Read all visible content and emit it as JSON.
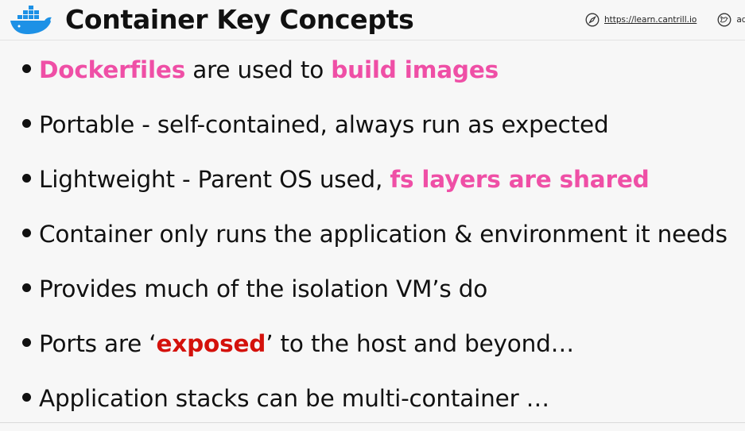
{
  "header": {
    "title": "Container Key Concepts",
    "website": "https://learn.cantrill.io",
    "social": "adria",
    "icons": {
      "logo": "docker-whale-icon",
      "website": "compass-icon",
      "social": "twitter-bird-icon"
    }
  },
  "colors": {
    "accent_pink": "#ef4fa6",
    "accent_red": "#d4110b",
    "docker_blue": "#1d91e6"
  },
  "bullets": [
    {
      "parts": [
        {
          "text": "Dockerfiles",
          "style": "pink"
        },
        {
          "text": " are used to "
        },
        {
          "text": "build images",
          "style": "pink"
        }
      ]
    },
    {
      "parts": [
        {
          "text": "Portable - self-contained, always run as expected"
        }
      ]
    },
    {
      "parts": [
        {
          "text": "Lightweight - Parent OS used, "
        },
        {
          "text": "fs layers are shared",
          "style": "pink"
        }
      ]
    },
    {
      "parts": [
        {
          "text": "Container only runs the application & environment it needs"
        }
      ]
    },
    {
      "parts": [
        {
          "text": "Provides much of the isolation VM’s do"
        }
      ]
    },
    {
      "parts": [
        {
          "text": "Ports are ‘"
        },
        {
          "text": "exposed",
          "style": "red"
        },
        {
          "text": "’ to the host and beyond…"
        }
      ]
    },
    {
      "parts": [
        {
          "text": "Application stacks can be multi-container …"
        }
      ]
    }
  ]
}
